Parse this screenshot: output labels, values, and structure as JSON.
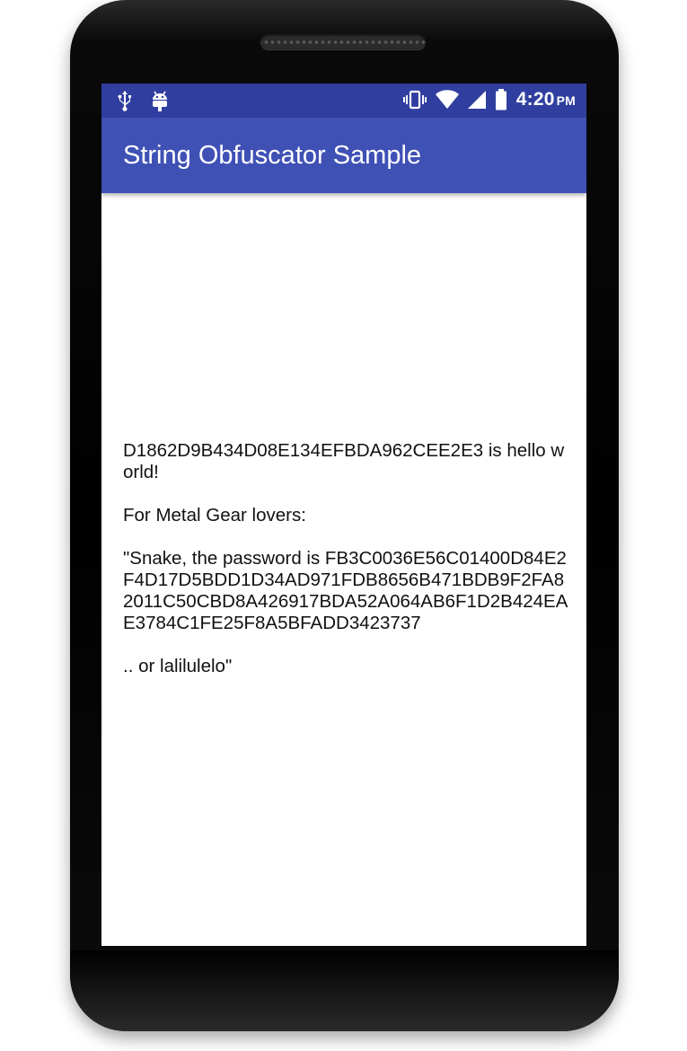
{
  "status_bar": {
    "icons_left": [
      "usb-icon",
      "android-debug-icon"
    ],
    "icons_right": [
      "vibrate-icon",
      "wifi-icon",
      "cell-signal-icon",
      "battery-icon"
    ],
    "time": "4:20",
    "ampm": "PM"
  },
  "app_bar": {
    "title": "String Obfuscator Sample"
  },
  "content": {
    "line1": "D1862D9B434D08E134EFBDA962CEE2E3 is hello world!",
    "line2": "For Metal Gear lovers:",
    "line3": "\"Snake, the password is FB3C0036E56C01400D84E2F4D17D5BDD1D34AD971FDB8656B471BDB9F2FA82011C50CBD8A426917BDA52A064AB6F1D2B424EAE3784C1FE25F8A5BFADD3423737",
    "line4": ".. or lalilulelo\""
  },
  "colors": {
    "status_bar": "#303f9f",
    "app_bar": "#3f51b5",
    "text": "#111111"
  }
}
